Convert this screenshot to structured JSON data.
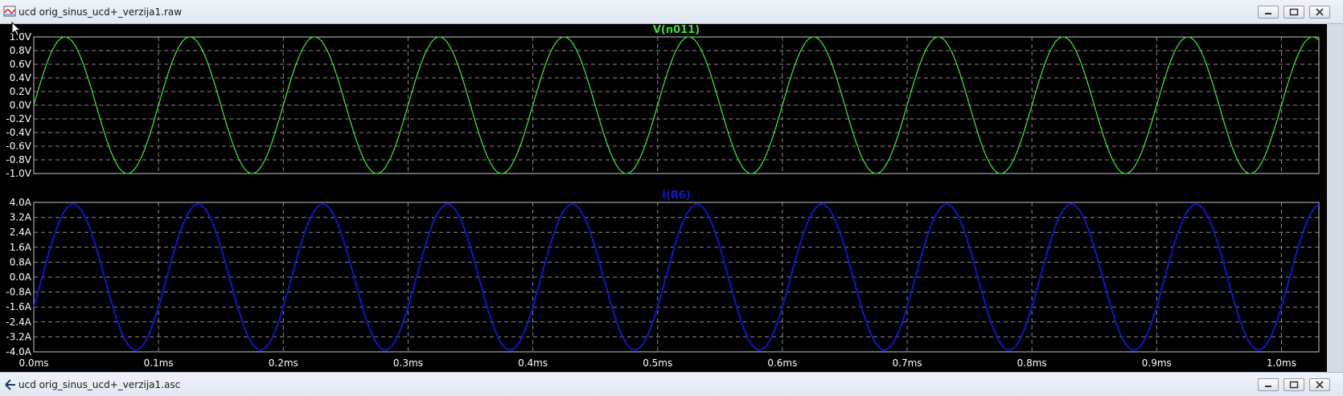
{
  "top_window": {
    "title": "ucd orig_sinus_ucd+_verzija1.raw"
  },
  "bottom_window": {
    "title": "ucd orig_sinus_ucd+_verzija1.asc"
  },
  "icons": {
    "waveform_app": "waveform-icon",
    "schematic_app": "schematic-icon",
    "minimize": "minimize-icon",
    "maximize": "maximize-icon",
    "close": "close-icon",
    "cursor": "mouse-pointer-icon"
  },
  "colors": {
    "voltage_trace": "#3cdc3c",
    "current_trace": "#1414c8",
    "voltage_title": "#3cdc3c",
    "current_title": "#1414c8",
    "background": "#000000",
    "grid": "#8a8a8a"
  },
  "chart_data": [
    {
      "type": "line",
      "title": "V(n011)",
      "xlabel": "",
      "ylabel": "",
      "y_ticks": [
        "1.0V",
        "0.8V",
        "0.6V",
        "0.4V",
        "0.2V",
        "0.0V",
        "-0.2V",
        "-0.4V",
        "-0.6V",
        "-0.8V",
        "-1.0V"
      ],
      "ylim": [
        -1.0,
        1.0
      ],
      "xlim": [
        0,
        1.03
      ],
      "x_unit": "ms",
      "grid": true,
      "series": [
        {
          "name": "V(n011)",
          "amplitude": 1.0,
          "frequency_khz": 10,
          "phase_deg": 0,
          "offset": 0
        }
      ]
    },
    {
      "type": "line",
      "title": "I(R6)",
      "xlabel": "",
      "ylabel": "",
      "y_ticks": [
        "4.0A",
        "3.2A",
        "2.4A",
        "1.6A",
        "0.8A",
        "0.0A",
        "-0.8A",
        "-1.6A",
        "-2.4A",
        "-3.2A",
        "-4.0A"
      ],
      "ylim": [
        -4.0,
        4.0
      ],
      "xlim": [
        0,
        1.03
      ],
      "x_unit": "ms",
      "grid": true,
      "series": [
        {
          "name": "I(R6)",
          "amplitude": 3.9,
          "frequency_khz": 10,
          "phase_deg": -24,
          "offset": 0
        }
      ]
    }
  ],
  "x_ticks": [
    "0.0ms",
    "0.1ms",
    "0.2ms",
    "0.3ms",
    "0.4ms",
    "0.5ms",
    "0.6ms",
    "0.7ms",
    "0.8ms",
    "0.9ms",
    "1.0ms"
  ],
  "x_tick_values": [
    0,
    0.1,
    0.2,
    0.3,
    0.4,
    0.5,
    0.6,
    0.7,
    0.8,
    0.9,
    1.0
  ]
}
